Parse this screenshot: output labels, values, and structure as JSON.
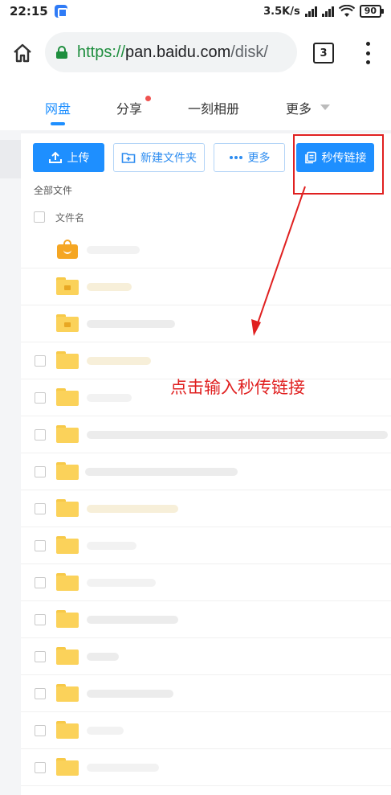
{
  "status_bar": {
    "time": "22:15",
    "net_speed": "3.5K/s",
    "battery": "90"
  },
  "browser": {
    "url_scheme": "https://",
    "url_host": "pan.baidu.com",
    "url_path": "/disk/",
    "tab_count": "3"
  },
  "app_tabs": [
    {
      "label": "网盘",
      "active": true
    },
    {
      "label": "分享",
      "has_dot": true
    },
    {
      "label": "一刻相册"
    },
    {
      "label": "更多",
      "has_caret": true
    }
  ],
  "toolbar": {
    "upload_label": "上传",
    "new_folder_label": "新建文件夹",
    "more_label": "更多",
    "instant_link_label": "秒传链接"
  },
  "breadcrumb": "全部文件",
  "list_header": {
    "filename_label": "文件名"
  },
  "annotation": {
    "text": "点击输入秒传链接",
    "color": "#e02020"
  },
  "colors": {
    "accent": "#1e8fff",
    "folder": "#fbd25a"
  }
}
